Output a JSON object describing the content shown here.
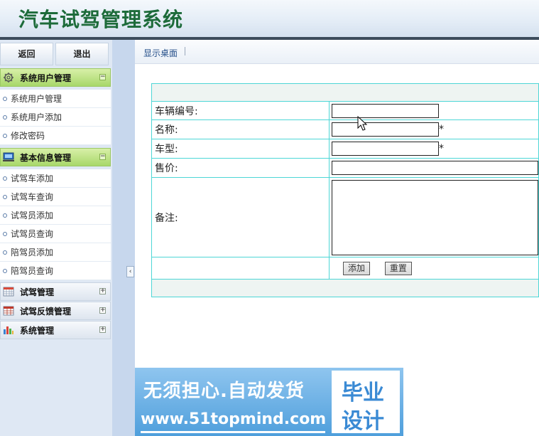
{
  "header": {
    "title": "汽车试驾管理系统"
  },
  "sidebar": {
    "back_label": "返回",
    "exit_label": "退出",
    "groups": [
      {
        "label": "系统用户管理",
        "icon": "gear-icon",
        "state": "expanded",
        "items": [
          "系统用户管理",
          "系统用户添加",
          "修改密码"
        ]
      },
      {
        "label": "基本信息管理",
        "icon": "monitor-icon",
        "state": "expanded",
        "items": [
          "试驾车添加",
          "试驾车查询",
          "试驾员添加",
          "试驾员查询",
          "陪驾员添加",
          "陪驾员查询"
        ]
      },
      {
        "label": "试驾管理",
        "icon": "calendar-icon",
        "state": "collapsed",
        "items": []
      },
      {
        "label": "试驾反馈管理",
        "icon": "table-icon",
        "state": "collapsed",
        "items": []
      },
      {
        "label": "系统管理",
        "icon": "chart-icon",
        "state": "collapsed",
        "items": []
      }
    ],
    "expanded_symbol": "−",
    "collapsed_symbol": "+",
    "collapse_handle": "‹"
  },
  "main": {
    "tab_label": "显示桌面",
    "form": {
      "fields": [
        {
          "label": "车辆编号:",
          "value": "",
          "required": false
        },
        {
          "label": "名称:",
          "value": "",
          "required": true
        },
        {
          "label": "车型:",
          "value": "",
          "required": true
        },
        {
          "label": "售价:",
          "value": ""
        },
        {
          "label": "备注:",
          "value": ""
        }
      ],
      "required_mark": "*",
      "add_button": "添加",
      "reset_button": "重置"
    }
  },
  "ad": {
    "line1": "无须担心.自动发货",
    "line2": "www.51topmind.com",
    "box_line1": "毕业",
    "box_line2": "设计"
  },
  "colors": {
    "header_title": "#1d6b3a",
    "group_open": "#a8d86a",
    "table_border": "#4dd6d6",
    "sidebar_bg": "#dfe8f4",
    "splitter_bg": "#c7d7ed",
    "ad_bg": "#4f9fdc"
  }
}
